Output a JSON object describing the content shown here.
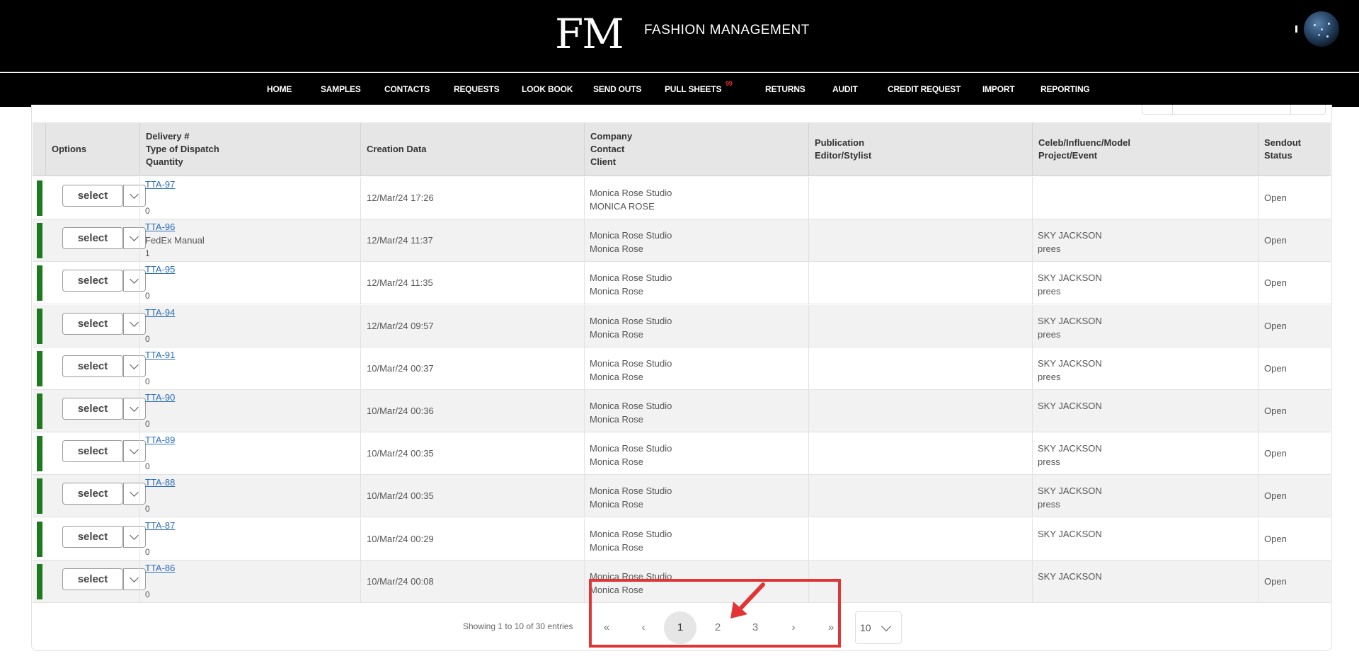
{
  "header": {
    "logo": "FM",
    "brand": "FASHION MANAGEMENT",
    "dot": "!"
  },
  "nav": {
    "items": [
      {
        "label": "HOME"
      },
      {
        "label": "SAMPLES"
      },
      {
        "label": "CONTACTS"
      },
      {
        "label": "REQUESTS"
      },
      {
        "label": "LOOK BOOK"
      },
      {
        "label": "SEND OUTS"
      },
      {
        "label": "PULL SHEETS",
        "badge": "99"
      },
      {
        "label": "RETURNS"
      },
      {
        "label": "AUDIT"
      },
      {
        "label": "CREDIT REQUEST"
      },
      {
        "label": "IMPORT"
      },
      {
        "label": "REPORTING"
      }
    ]
  },
  "table": {
    "headers": {
      "options": "Options",
      "delivery": [
        "Delivery #",
        "Type of Dispatch",
        "Quantity"
      ],
      "creation": "Creation Data",
      "company": [
        "Company",
        "Contact",
        "Client"
      ],
      "publication": [
        "Publication",
        "Editor/Stylist"
      ],
      "celeb": [
        "Celeb/Influenc/Model",
        "Project/Event"
      ],
      "status": [
        "Sendout",
        "Status"
      ]
    },
    "select_label": "select",
    "rows": [
      {
        "id": "TTA-97",
        "type": "",
        "qty": "0",
        "date": "12/Mar/24 17:26",
        "company": "Monica Rose Studio",
        "contact": "MONICA ROSE",
        "celeb": "",
        "project": "",
        "status": "Open"
      },
      {
        "id": "TTA-96",
        "type": "FedEx Manual",
        "qty": "1",
        "date": "12/Mar/24 11:37",
        "company": "Monica Rose Studio",
        "contact": "Monica Rose",
        "celeb": "SKY JACKSON",
        "project": "prees",
        "status": "Open"
      },
      {
        "id": "TTA-95",
        "type": "",
        "qty": "0",
        "date": "12/Mar/24 11:35",
        "company": "Monica Rose Studio",
        "contact": "Monica Rose",
        "celeb": "SKY JACKSON",
        "project": "prees",
        "status": "Open"
      },
      {
        "id": "TTA-94",
        "type": "",
        "qty": "0",
        "date": "12/Mar/24 09:57",
        "company": "Monica Rose Studio",
        "contact": "Monica Rose",
        "celeb": "SKY JACKSON",
        "project": "prees",
        "status": "Open"
      },
      {
        "id": "TTA-91",
        "type": "",
        "qty": "0",
        "date": "10/Mar/24 00:37",
        "company": "Monica Rose Studio",
        "contact": "Monica Rose",
        "celeb": "SKY JACKSON",
        "project": "prees",
        "status": "Open"
      },
      {
        "id": "TTA-90",
        "type": "",
        "qty": "0",
        "date": "10/Mar/24 00:36",
        "company": "Monica Rose Studio",
        "contact": "Monica Rose",
        "celeb": "SKY JACKSON",
        "project": "",
        "status": "Open"
      },
      {
        "id": "TTA-89",
        "type": "",
        "qty": "0",
        "date": "10/Mar/24 00:35",
        "company": "Monica Rose Studio",
        "contact": "Monica Rose",
        "celeb": "SKY JACKSON",
        "project": "press",
        "status": "Open"
      },
      {
        "id": "TTA-88",
        "type": "",
        "qty": "0",
        "date": "10/Mar/24 00:35",
        "company": "Monica Rose Studio",
        "contact": "Monica Rose",
        "celeb": "SKY JACKSON",
        "project": "press",
        "status": "Open"
      },
      {
        "id": "TTA-87",
        "type": "",
        "qty": "0",
        "date": "10/Mar/24 00:29",
        "company": "Monica Rose Studio",
        "contact": "Monica Rose",
        "celeb": "SKY JACKSON",
        "project": "",
        "status": "Open"
      },
      {
        "id": "TTA-86",
        "type": "",
        "qty": "0",
        "date": "10/Mar/24 00:08",
        "company": "Monica Rose Studio",
        "contact": "Monica Rose",
        "celeb": "SKY JACKSON",
        "project": "",
        "status": "Open"
      }
    ]
  },
  "pagination": {
    "showing": "Showing 1 to 10 of 30 entries",
    "first": "«",
    "prev": "‹",
    "pages": [
      "1",
      "2",
      "3"
    ],
    "current": "1",
    "next": "›",
    "last": "»",
    "page_size": "10"
  },
  "colors": {
    "header_bg": "#000000",
    "accent_green": "#1f7a1f",
    "link": "#2a6ebb",
    "highlight": "#e23434"
  }
}
